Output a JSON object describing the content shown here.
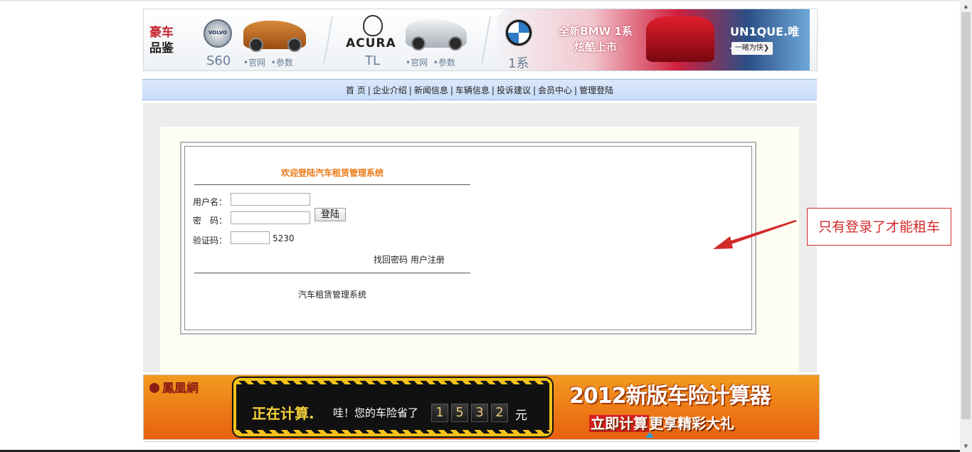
{
  "banner": {
    "title_line1": "豪车",
    "title_line2": "品鉴",
    "volvo": {
      "logo_text": "VOLVO",
      "model": "S60",
      "link_official": "•官网",
      "link_params": "•参数"
    },
    "acura": {
      "logo_text": "ACURA",
      "model": "TL",
      "link_official": "•官网",
      "link_params": "•参数"
    },
    "bmw": {
      "model": "1系",
      "tagline_line1": "全新BMW 1系",
      "tagline_line2": "炫酷上市",
      "slogan": "UN1QUE.唯一",
      "button": "一睹为快❯"
    }
  },
  "nav": {
    "items": [
      "首 页",
      "企业介绍",
      "新闻信息",
      "车辆信息",
      "投诉建议",
      "会员中心",
      "管理登陆"
    ]
  },
  "login": {
    "welcome": "欢迎登陆汽车租赁管理系统",
    "username_label": "用户名：",
    "password_label": "密　码：",
    "captcha_label": "验证码：",
    "username_value": "",
    "password_value": "",
    "captcha_value": "",
    "captcha_code": "5230",
    "login_button": "登陆",
    "forgot_password": "找回密码",
    "register": "用户注册",
    "footer": "汽车租赁管理系统"
  },
  "annotation": {
    "text": "只有登录了才能租车",
    "color": "#d22a2a"
  },
  "bottom_ad": {
    "brand": "鳳凰網",
    "calc_title": "正在计算.",
    "calc_text": "哇！您的车险省了",
    "digits": [
      "1",
      "5",
      "3",
      "2"
    ],
    "unit": "元",
    "headline": "2012新版车险计算器",
    "sub_highlight": "立即计算",
    "sub_rest": "更享精彩大礼"
  }
}
